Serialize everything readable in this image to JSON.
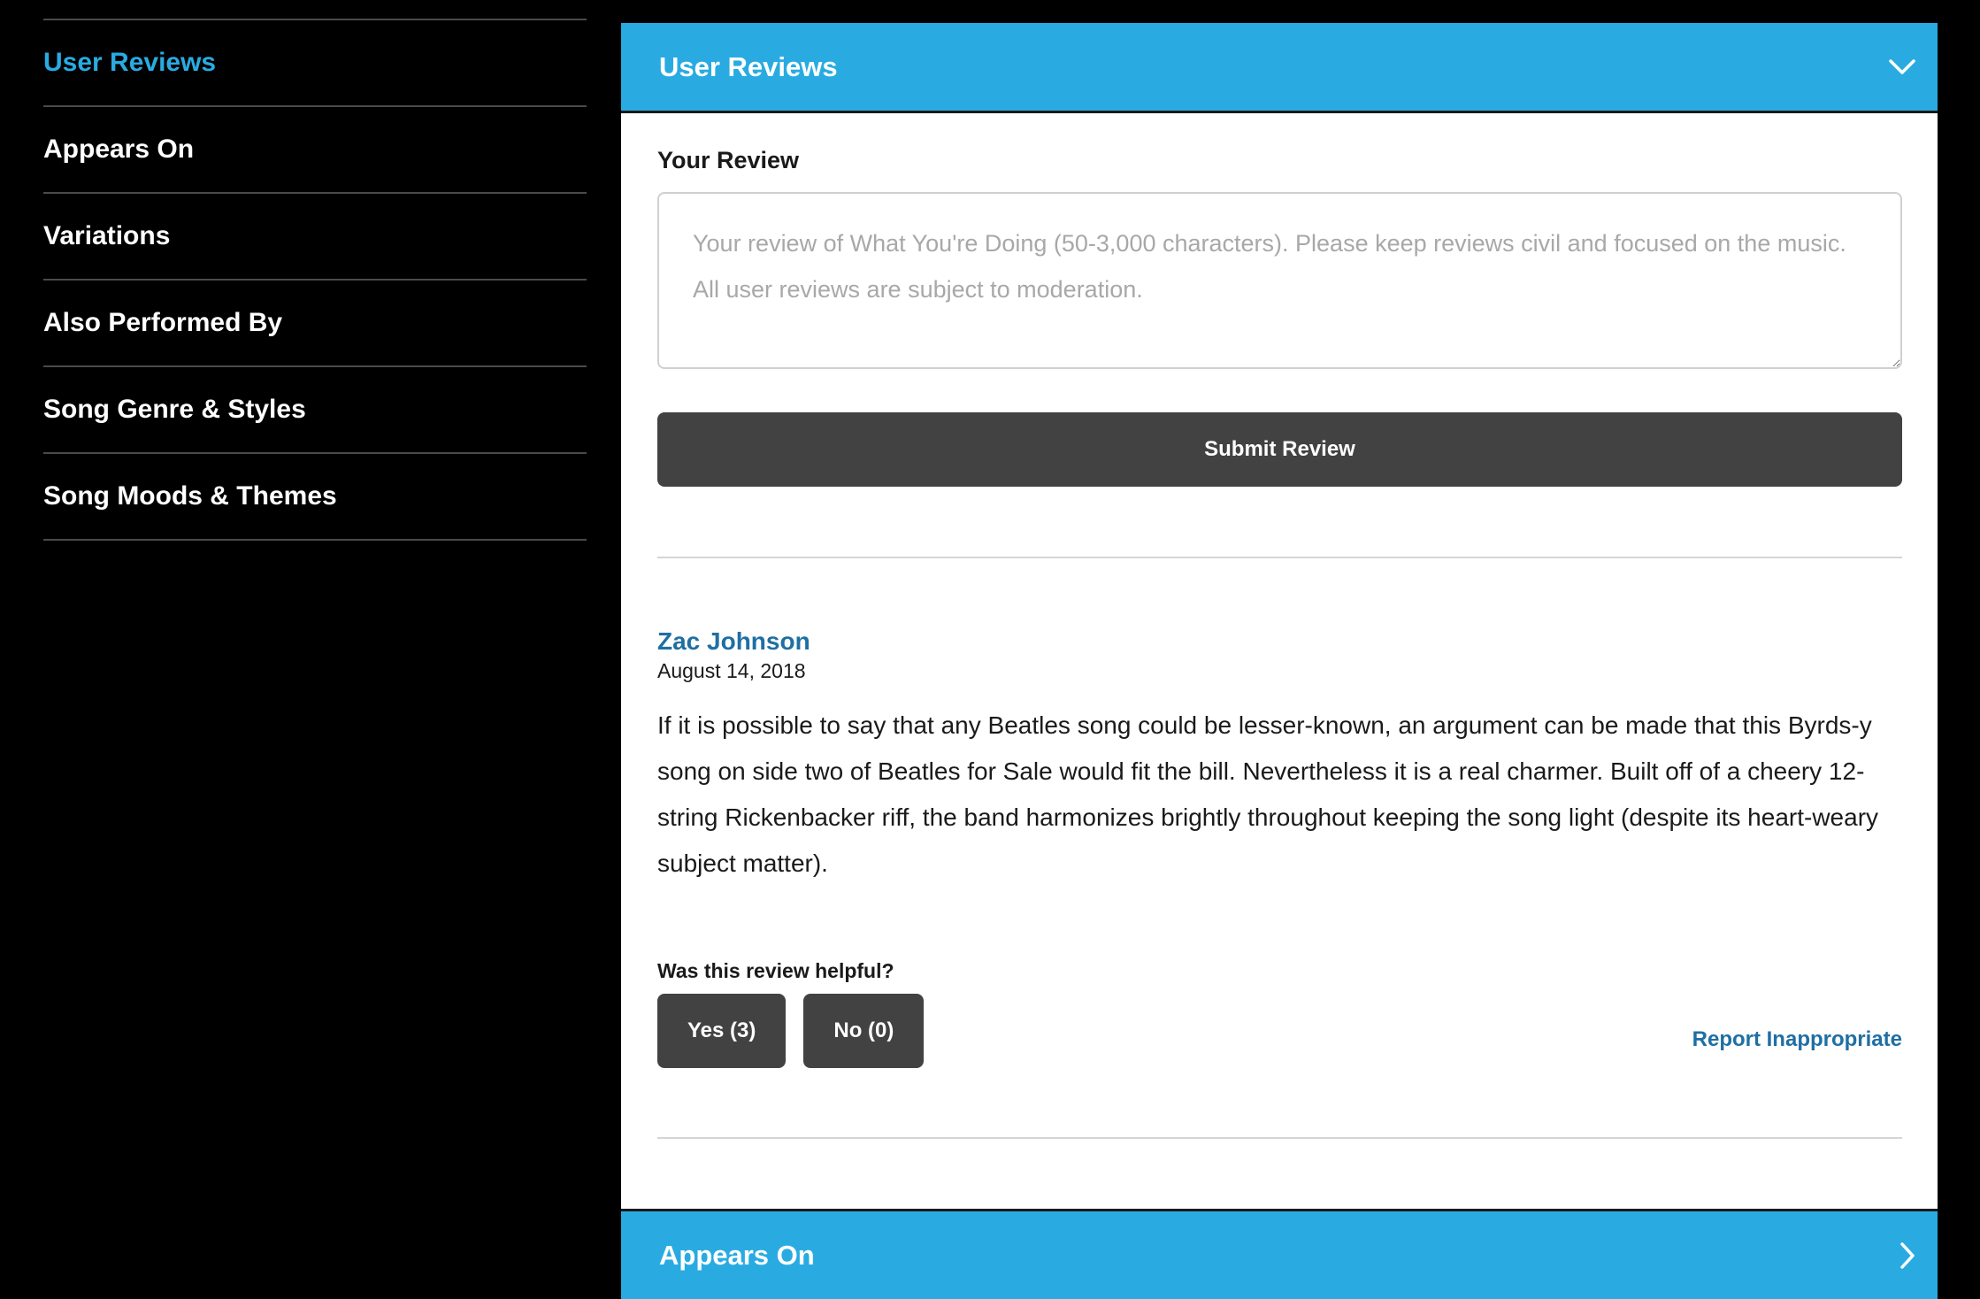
{
  "sidebar": {
    "items": [
      {
        "label": "User Reviews",
        "active": true
      },
      {
        "label": "Appears On"
      },
      {
        "label": "Variations"
      },
      {
        "label": "Also Performed By"
      },
      {
        "label": "Song Genre & Styles"
      },
      {
        "label": "Song Moods & Themes"
      }
    ]
  },
  "user_reviews_section": {
    "title": "User Reviews",
    "icon": "chevron-down-icon",
    "form": {
      "label": "Your Review",
      "placeholder": "Your review of What You're Doing (50-3,000 characters). Please keep reviews civil and focused on the music. All user reviews are subject to moderation.",
      "value": "",
      "submit_label": "Submit Review"
    },
    "review": {
      "author": "Zac Johnson",
      "date": "August 14, 2018",
      "text": "If it is possible to say that any Beatles song could be lesser-known, an argument can be made that this Byrds-y song on side two of Beatles for Sale would fit the bill. Nevertheless it is a real charmer. Built off of a cheery 12-string Rickenbacker riff, the band harmonizes brightly throughout keeping the song light (despite its heart-weary subject matter).",
      "helpful_prompt": "Was this review helpful?",
      "yes_label": "Yes (3)",
      "no_label": "No (0)",
      "report_label": "Report Inappropriate"
    }
  },
  "appears_on_section": {
    "title": "Appears On",
    "icon": "chevron-right-icon"
  },
  "colors": {
    "accent": "#29abe2",
    "link": "#1f6fa3",
    "button": "#424242",
    "background": "#000000"
  }
}
